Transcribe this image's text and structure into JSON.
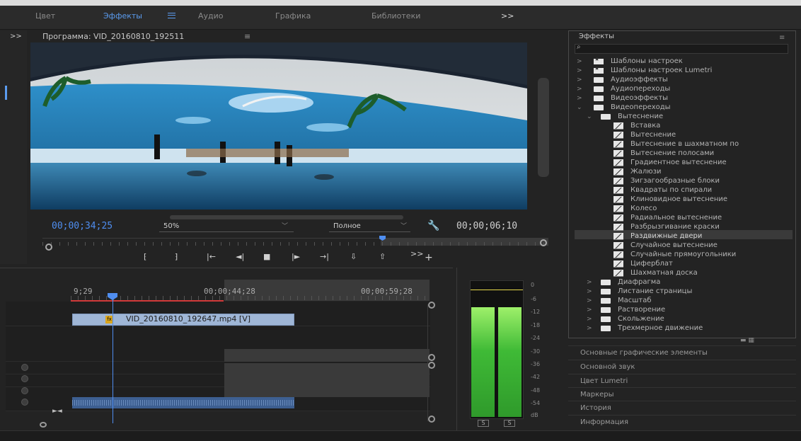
{
  "workspace": {
    "tabs": [
      "Цвет",
      "Эффекты",
      "Аудио",
      "Графика",
      "Библиотеки"
    ],
    "active_tab": "Эффекты",
    "overflow": ">>"
  },
  "left_strip": {
    "expand": ">>"
  },
  "program": {
    "title": "Программа: VID_20160810_192511",
    "menu": "≡",
    "timecode_current": "00;00;34;25",
    "zoom": "50%",
    "quality": "Полное",
    "timecode_duration": "00;00;06;10",
    "transport": [
      "⁅",
      "⁆",
      "|←",
      "◄|",
      "■",
      "|►",
      "→|",
      "⇩",
      "⇧",
      ">>",
      "+"
    ]
  },
  "timeline": {
    "timecodes": [
      "9;29",
      "00;00;44;28",
      "00;00;59;28"
    ],
    "video_clip_label": "VID_20160810_192647.mp4 [V]",
    "fx_badge": "fx",
    "nav": "►◄"
  },
  "meters": {
    "db_scale": [
      "0",
      "-6",
      "-12",
      "-18",
      "-24",
      "-30",
      "-36",
      "-42",
      "-48",
      "-54",
      "dB"
    ],
    "solo_buttons": [
      "S",
      "S"
    ]
  },
  "effects_panel": {
    "title": "Эффекты",
    "menu": "≡",
    "search_icon": "⌕",
    "items": [
      {
        "label": "Шаблоны настроек",
        "kind": "preset",
        "level": 0,
        "expanded": false
      },
      {
        "label": "Шаблоны настроек Lumetri",
        "kind": "preset",
        "level": 0,
        "expanded": false
      },
      {
        "label": "Аудиоэффекты",
        "kind": "folder",
        "level": 0,
        "expanded": false
      },
      {
        "label": "Аудиопереходы",
        "kind": "folder",
        "level": 0,
        "expanded": false
      },
      {
        "label": "Видеоэффекты",
        "kind": "folder",
        "level": 0,
        "expanded": false
      },
      {
        "label": "Видеопереходы",
        "kind": "folder",
        "level": 0,
        "expanded": true
      },
      {
        "label": "Вытеснение",
        "kind": "folder",
        "level": 1,
        "expanded": true
      },
      {
        "label": "Вставка",
        "kind": "effect",
        "level": 2
      },
      {
        "label": "Вытеснение",
        "kind": "effect",
        "level": 2
      },
      {
        "label": "Вытеснение в шахматном по",
        "kind": "effect",
        "level": 2
      },
      {
        "label": "Вытеснение полосами",
        "kind": "effect",
        "level": 2
      },
      {
        "label": "Градиентное вытеснение",
        "kind": "effect",
        "level": 2
      },
      {
        "label": "Жалюзи",
        "kind": "effect",
        "level": 2
      },
      {
        "label": "Зигзагообразные блоки",
        "kind": "effect",
        "level": 2
      },
      {
        "label": "Квадраты по спирали",
        "kind": "effect",
        "level": 2
      },
      {
        "label": "Клиновидное вытеснение",
        "kind": "effect",
        "level": 2
      },
      {
        "label": "Колесо",
        "kind": "effect",
        "level": 2
      },
      {
        "label": "Радиальное вытеснение",
        "kind": "effect",
        "level": 2
      },
      {
        "label": "Разбрызгивание краски",
        "kind": "effect",
        "level": 2
      },
      {
        "label": "Раздвижные двери",
        "kind": "effect",
        "level": 2,
        "selected": true
      },
      {
        "label": "Случайное вытеснение",
        "kind": "effect",
        "level": 2
      },
      {
        "label": "Случайные прямоугольники",
        "kind": "effect",
        "level": 2
      },
      {
        "label": "Циферблат",
        "kind": "effect",
        "level": 2
      },
      {
        "label": "Шахматная доска",
        "kind": "effect",
        "level": 2
      },
      {
        "label": "Диафрагма",
        "kind": "folder",
        "level": 1,
        "expanded": false
      },
      {
        "label": "Листание страницы",
        "kind": "folder",
        "level": 1,
        "expanded": false
      },
      {
        "label": "Масштаб",
        "kind": "folder",
        "level": 1,
        "expanded": false
      },
      {
        "label": "Растворение",
        "kind": "folder",
        "level": 1,
        "expanded": false
      },
      {
        "label": "Скольжение",
        "kind": "folder",
        "level": 1,
        "expanded": false
      },
      {
        "label": "Трехмерное движение",
        "kind": "folder",
        "level": 1,
        "expanded": false
      }
    ]
  },
  "collapsed_panels": [
    "Основные графические элементы",
    "Основной звук",
    "Цвет Lumetri",
    "Маркеры",
    "История",
    "Информация"
  ],
  "colors": {
    "accent": "#4f8ef0",
    "panel_bg": "#232323",
    "clip_video": "#9fb6d6",
    "clip_audio": "#3d5f91",
    "meter_green": "#3fba36"
  }
}
